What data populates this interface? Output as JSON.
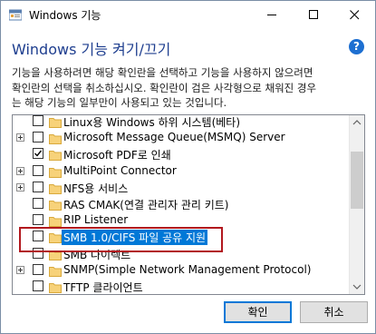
{
  "window": {
    "title": "Windows 기능"
  },
  "header": {
    "title": "Windows 기능 켜기/끄기",
    "help": "?"
  },
  "description": {
    "lines": [
      "기능을 사용하려면 해당 확인란을 선택하고 기능을 사용하지 않으려면",
      "확인란의 선택을 취소하십시오. 확인란이 검은 사각형으로 채워진 경우",
      "는 해당 기능의 일부만이 사용되고 있는 것입니다."
    ]
  },
  "features": [
    {
      "label": "Linux용 Windows 하위 시스템(베타)",
      "expandable": false,
      "checked": false
    },
    {
      "label": "Microsoft Message Queue(MSMQ) Server",
      "expandable": true,
      "checked": false
    },
    {
      "label": "Microsoft PDF로 인쇄",
      "expandable": false,
      "checked": true
    },
    {
      "label": "MultiPoint Connector",
      "expandable": true,
      "checked": false
    },
    {
      "label": "NFS용 서비스",
      "expandable": true,
      "checked": false
    },
    {
      "label": "RAS CMAK(연결 관리자 관리 키트)",
      "expandable": false,
      "checked": false
    },
    {
      "label": "RIP Listener",
      "expandable": false,
      "checked": false
    },
    {
      "label": "SMB 1.0/CIFS 파일 공유 지원",
      "expandable": false,
      "checked": false,
      "selected": true
    },
    {
      "label": "SMB 다이렉트",
      "expandable": false,
      "checked": false
    },
    {
      "label": "SNMP(Simple Network Management Protocol)",
      "expandable": true,
      "checked": false
    },
    {
      "label": "TFTP 클라이언트",
      "expandable": false,
      "checked": false
    }
  ],
  "buttons": {
    "ok": "확인",
    "cancel": "취소"
  },
  "colors": {
    "accent": "#0078d7",
    "heading": "#1e3e8f",
    "highlight_frame": "#b2181e",
    "folder": "#f7d27a"
  }
}
